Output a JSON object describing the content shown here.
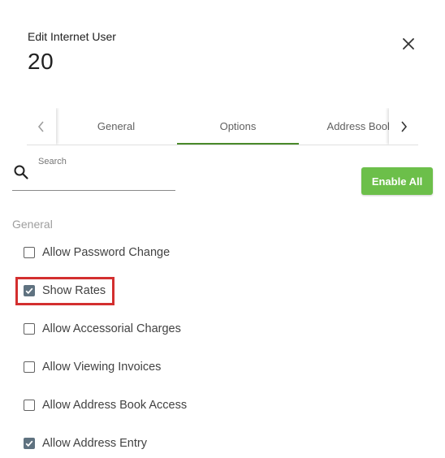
{
  "header": {
    "subtitle": "Edit Internet User",
    "title": "20"
  },
  "tabs": [
    {
      "label": "General",
      "active": false
    },
    {
      "label": "Options",
      "active": true
    },
    {
      "label": "Address Book",
      "active": false
    }
  ],
  "search": {
    "label": "Search",
    "value": ""
  },
  "enable_all_label": "Enable All",
  "section_label": "General",
  "options": [
    {
      "label": "Allow Password Change",
      "checked": false
    },
    {
      "label": "Show Rates",
      "checked": true,
      "highlighted": true
    },
    {
      "label": "Allow Accessorial Charges",
      "checked": false
    },
    {
      "label": "Allow Viewing Invoices",
      "checked": false
    },
    {
      "label": "Allow Address Book Access",
      "checked": false
    },
    {
      "label": "Allow Address Entry",
      "checked": true
    }
  ],
  "colors": {
    "accent": "#6cbf4a",
    "tab_ink": "#4a8a2a",
    "checkbox_checked": "#5f7280",
    "highlight": "#d32f2f"
  },
  "icons": {
    "close": "close-icon",
    "search": "search-icon",
    "prev": "chevron-left-icon",
    "next": "chevron-right-icon",
    "check": "check-icon"
  }
}
